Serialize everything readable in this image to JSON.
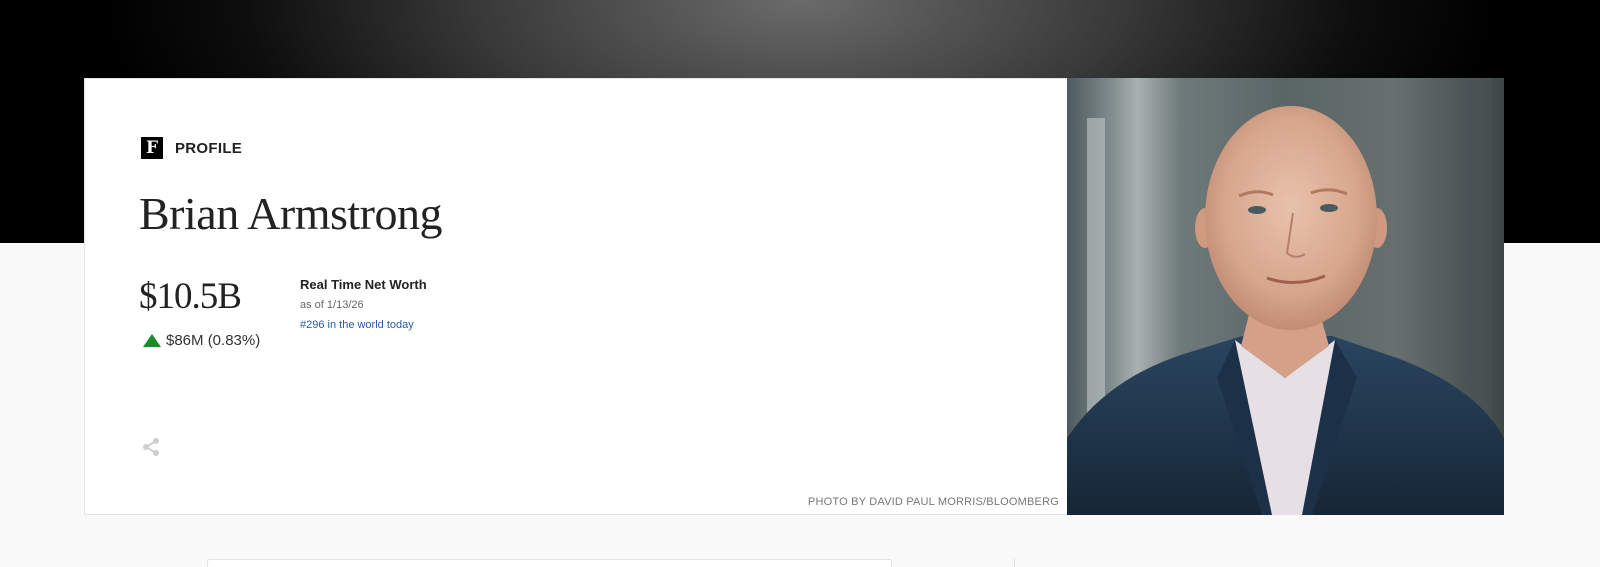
{
  "header": {
    "logo_letter": "F",
    "section_label": "PROFILE"
  },
  "profile": {
    "name": "Brian Armstrong",
    "net_worth": "$10.5B",
    "change": "$86M (0.83%)",
    "change_direction": "up",
    "net_worth_title": "Real Time Net Worth",
    "as_of": "as of 1/13/26",
    "rank": "#296 in the world today"
  },
  "photo": {
    "credit": "PHOTO BY DAVID PAUL MORRIS/BLOOMBERG"
  },
  "colors": {
    "positive_green": "#1a8a2a",
    "rank_link_blue": "#2a5aa8",
    "jacket_navy": "#1f3347"
  },
  "icons": {
    "share": "share-icon",
    "trend": "up-arrow-icon"
  }
}
